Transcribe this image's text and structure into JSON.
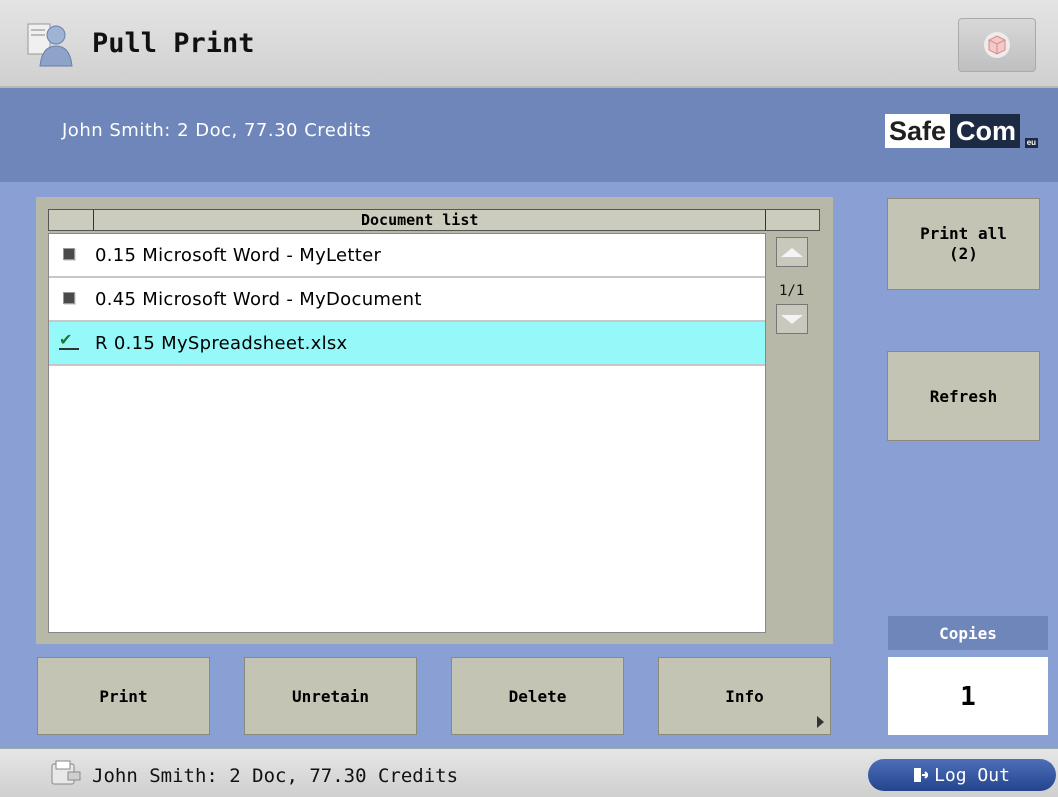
{
  "app": {
    "title": "Pull Print"
  },
  "info_bar": {
    "user_summary": "John Smith: 2 Doc, 77.30 Credits"
  },
  "logo": {
    "part1": "Safe",
    "part2": "Com",
    "suffix": "eu"
  },
  "document_list": {
    "header": "Document list",
    "page_indicator": "1/1",
    "items": [
      {
        "label": "0.15 Microsoft Word - MyLetter",
        "selected": false
      },
      {
        "label": "0.45 Microsoft Word - MyDocument",
        "selected": false
      },
      {
        "label": "R 0.15 MySpreadsheet.xlsx",
        "selected": true
      }
    ]
  },
  "side_buttons": {
    "print_all": "Print all\n(2)",
    "refresh": "Refresh"
  },
  "bottom_buttons": {
    "print": "Print",
    "unretain": "Unretain",
    "delete": "Delete",
    "info": "Info"
  },
  "copies": {
    "label": "Copies",
    "value": "1"
  },
  "status_bar": {
    "text": "John Smith: 2 Doc, 77.30 Credits",
    "logout_label": "Log Out"
  },
  "colors": {
    "selected_row": "#96f9f9",
    "info_bar": "#6e86ba",
    "background": "#8aa0d4"
  },
  "icons": {
    "app": "user-icon",
    "top_right": "cube-icon",
    "status": "device-icon",
    "logout": "exit-icon",
    "checked": "check-icon"
  }
}
